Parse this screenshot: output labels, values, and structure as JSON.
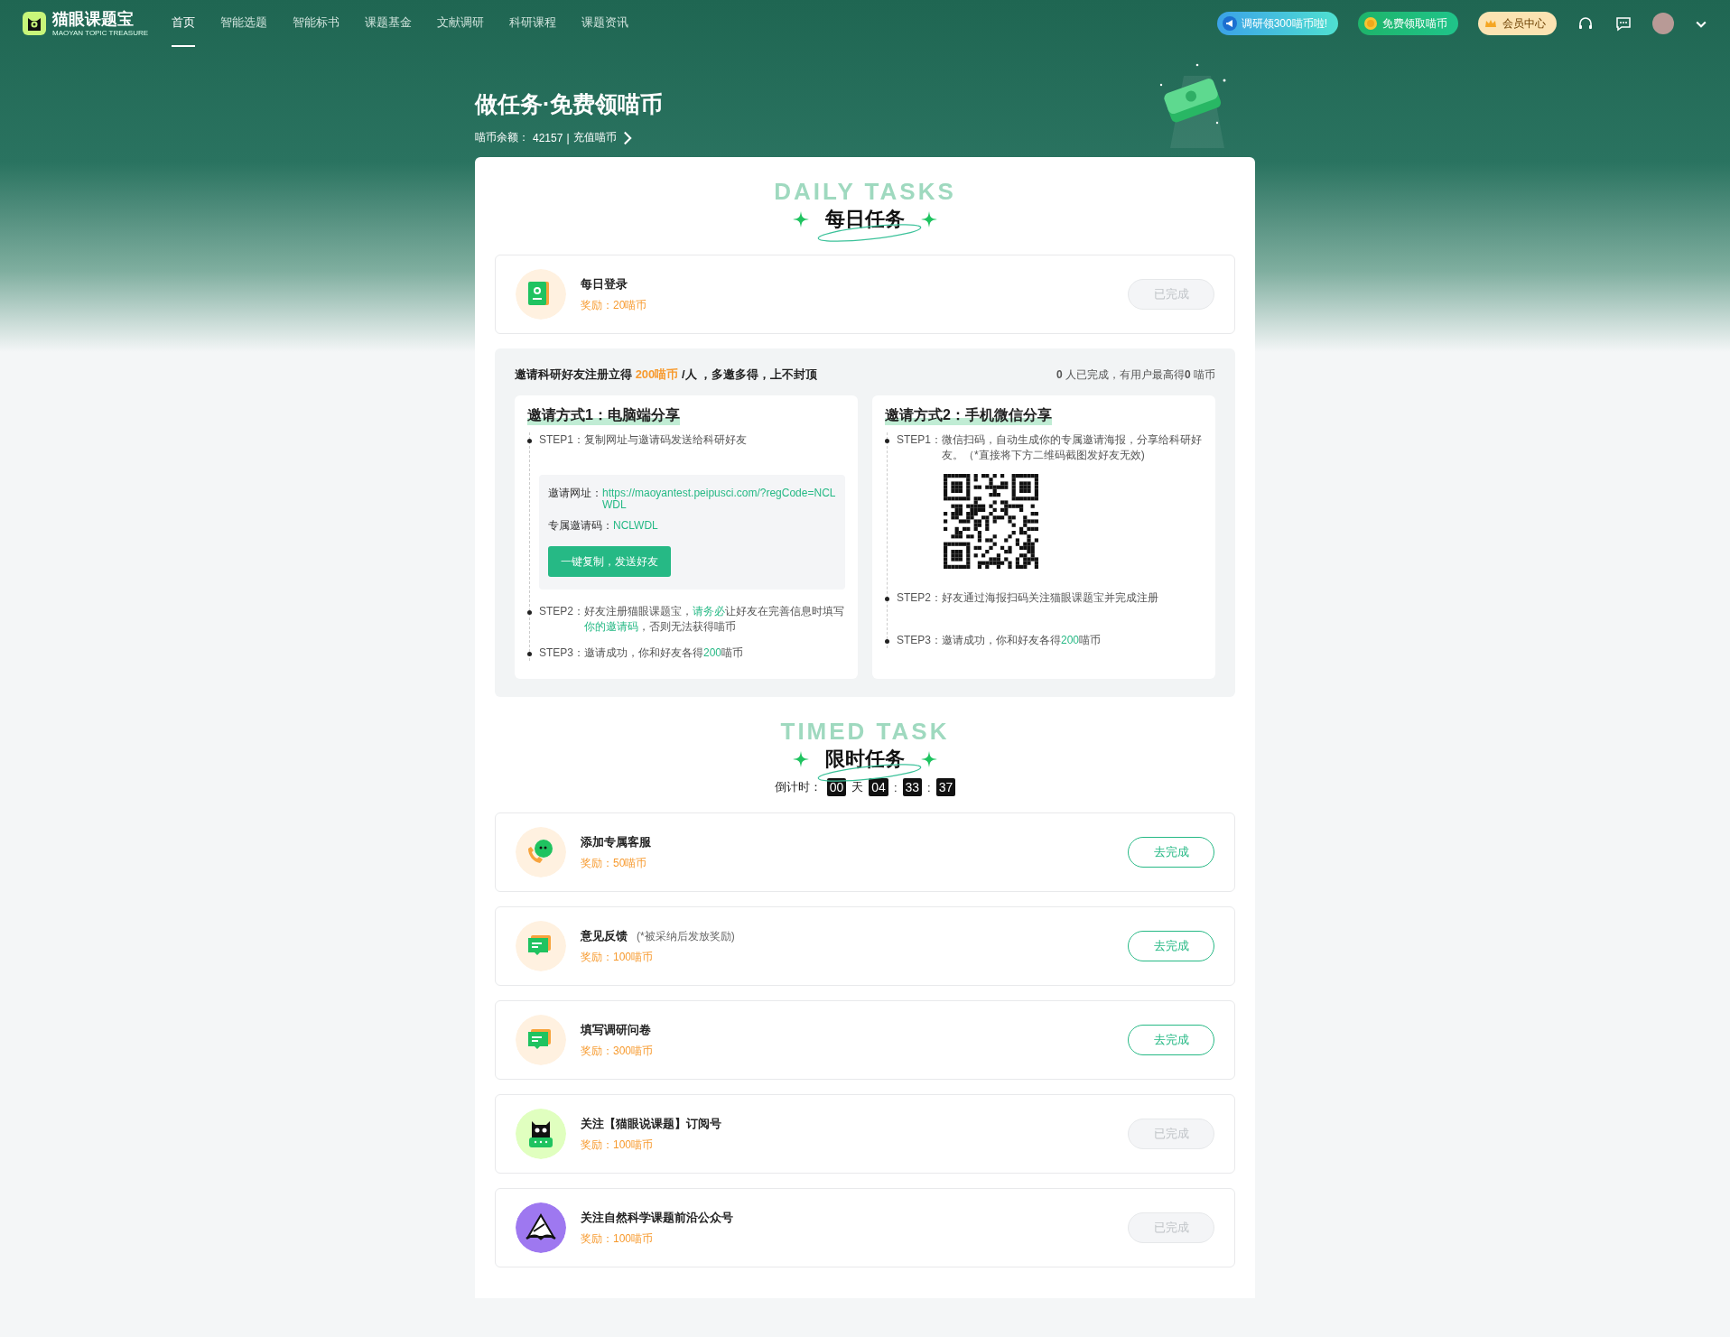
{
  "nav": {
    "logo": {
      "name": "猫眼课题宝",
      "subtitle": "MAOYAN TOPIC TREASURE"
    },
    "items": [
      {
        "label": "首页",
        "selected": true
      },
      {
        "label": "智能选题",
        "selected": false
      },
      {
        "label": "智能标书",
        "selected": false
      },
      {
        "label": "课题基金",
        "selected": false
      },
      {
        "label": "文献调研",
        "selected": false
      },
      {
        "label": "科研课程",
        "selected": false
      },
      {
        "label": "课题资讯",
        "selected": false
      }
    ],
    "promos": [
      {
        "label": "调研领300喵币啦!",
        "kind": "survey"
      },
      {
        "label": "免费领取喵币",
        "kind": "coin"
      },
      {
        "label": "会员中心",
        "kind": "vip"
      }
    ]
  },
  "header": {
    "title": "做任务·免费领喵币",
    "balance_label": "喵币余额：",
    "balance": "42157",
    "separator": "|",
    "recharge": "充值喵币"
  },
  "daily": {
    "heading": "每日任务",
    "watermark": "DAILY TASKS",
    "tasks": [
      {
        "kind": "login",
        "title": "每日登录",
        "reward": "奖励：20喵币",
        "button": "已完成",
        "done": true
      }
    ]
  },
  "invite": {
    "headline": [
      {
        "text": "邀请科研好友注册立得 ",
        "accent": false
      },
      {
        "text": "200喵币",
        "accent": true
      },
      {
        "text": " /人 ，多邀多得，上不封顶",
        "accent": false
      }
    ],
    "stats": "**0** 人已完成，有用户最高得**0** 喵币",
    "methods": [
      {
        "kind": "pc",
        "title": "邀请方式1：电脑端分享",
        "steps": [
          {
            "label": "STEP1：",
            "segments": [
              {
                "text": "复制网址与邀请码发送给科研好友",
                "accent": false
              }
            ]
          },
          {
            "label": "STEP2：",
            "segments": [
              {
                "text": "好友注册猫眼课题宝，",
                "accent": false
              },
              {
                "text": "请务必",
                "accent": true
              },
              {
                "text": "让好友在完善信息时填写",
                "accent": false
              },
              {
                "text": "你的邀请码",
                "accent": true
              },
              {
                "text": "，否则无法获得喵币",
                "accent": false
              }
            ]
          },
          {
            "label": "STEP3：",
            "segments": [
              {
                "text": "邀请成功，你和好友各得",
                "accent": false
              },
              {
                "text": "200",
                "accent": true
              },
              {
                "text": "喵币",
                "accent": false
              }
            ]
          }
        ],
        "share": {
          "url_label": "邀请网址：",
          "url": "https://maoyantest.peipusci.com/?regCode=NCLWDL",
          "code_label": "专属邀请码：",
          "code": "NCLWDL",
          "button": "一键复制，发送好友"
        }
      },
      {
        "kind": "mobile",
        "title": "邀请方式2：手机微信分享",
        "steps": [
          {
            "label": "STEP1：",
            "segments": [
              {
                "text": "微信扫码，自动生成你的专属邀请海报，分享给科研好友。（*直接将下方二维码截图发好友无效)",
                "accent": false
              }
            ]
          },
          {
            "label": "STEP2：",
            "segments": [
              {
                "text": "好友通过海报扫码关注猫眼课题宝并完成注册",
                "accent": false
              }
            ]
          },
          {
            "label": "STEP3：",
            "segments": [
              {
                "text": "邀请成功，你和好友各得",
                "accent": false
              },
              {
                "text": "200",
                "accent": true
              },
              {
                "text": "喵币",
                "accent": false
              }
            ]
          }
        ]
      }
    ]
  },
  "timed": {
    "heading": "限时任务",
    "watermark": "TIMED TASK",
    "countdown_label": "倒计时：",
    "countdown": [
      {
        "text": "00",
        "kind": "digit"
      },
      {
        "text": "天",
        "kind": "unit"
      },
      {
        "text": "04",
        "kind": "digit"
      },
      {
        "text": ":",
        "kind": "unit"
      },
      {
        "text": "33",
        "kind": "digit"
      },
      {
        "text": ":",
        "kind": "unit"
      },
      {
        "text": "37",
        "kind": "digit"
      }
    ],
    "tasks": [
      {
        "kind": "service",
        "title": "添加专属客服",
        "reward": "奖励：50喵币",
        "button": "去完成",
        "done": false
      },
      {
        "kind": "feedback",
        "title": "意见反馈",
        "note": "(*被采纳后发放奖励)",
        "reward": "奖励：100喵币",
        "button": "去完成",
        "done": false
      },
      {
        "kind": "feedback",
        "title": "填写调研问卷",
        "reward": "奖励：300喵币",
        "button": "去完成",
        "done": false
      },
      {
        "kind": "cat",
        "title": "关注【猫眼说课题】订阅号",
        "reward": "奖励：100喵币",
        "button": "已完成",
        "done": true
      },
      {
        "kind": "pyramid",
        "title": "关注自然科学课题前沿公众号",
        "reward": "奖励：100喵币",
        "button": "已完成",
        "done": true
      }
    ]
  }
}
